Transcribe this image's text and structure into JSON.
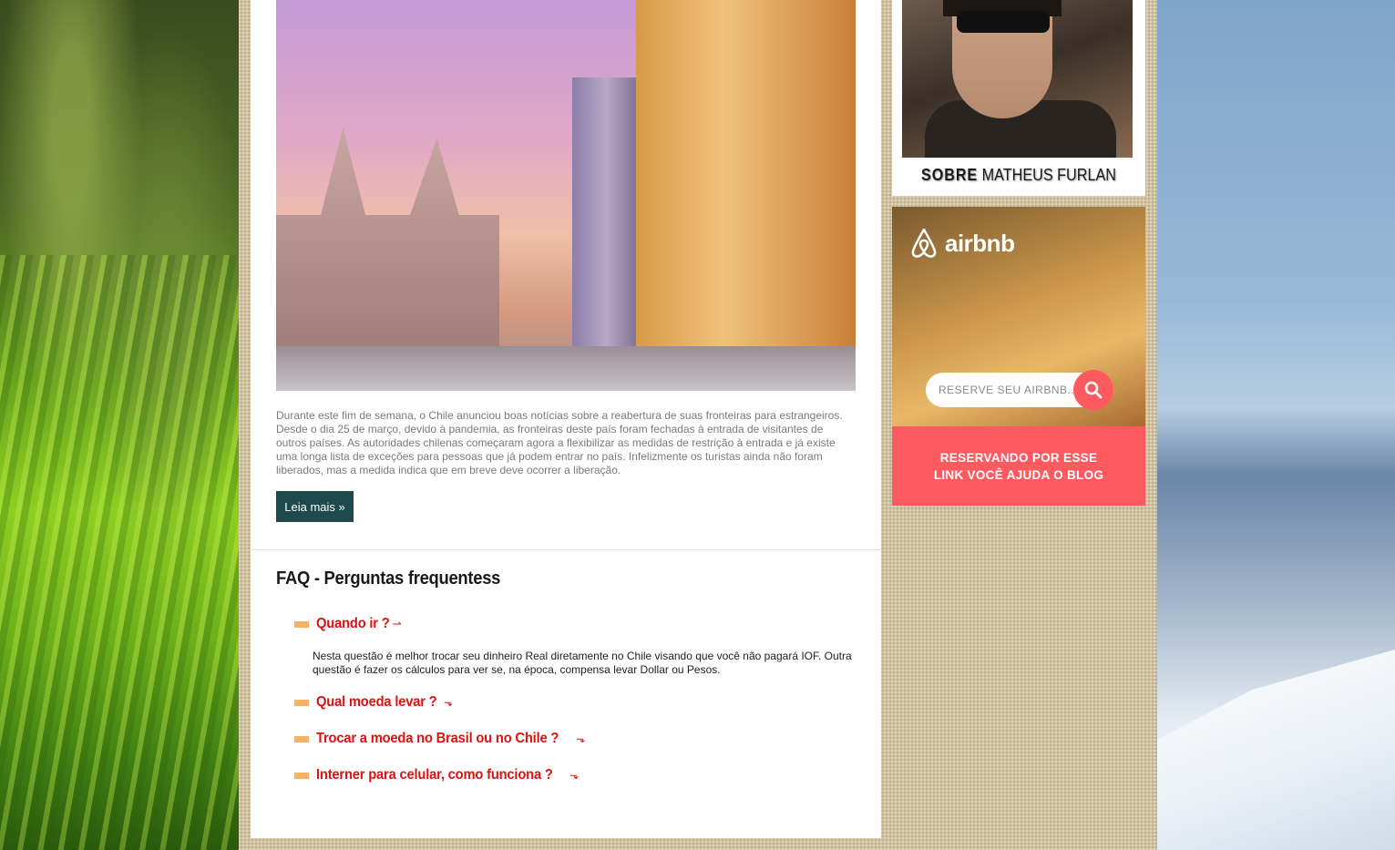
{
  "article": {
    "text": "Durante este fim de semana, o Chile anunciou boas notícias sobre a reabertura de suas fronteiras para estrangeiros. Desde o dia 25 de março, devido à pandemia, as fronteiras deste país foram fechadas à entrada de visitantes de outros países. As autoridades chilenas começaram agora a flexibilizar as medidas de restrição à entrada e já existe uma longa lista de exceções para pessoas que já podem entrar no país. Infelizmente os turistas ainda não foram liberados, mas a medida indica que em breve deve ocorrer a liberação.",
    "read_more_label": "Leia mais »"
  },
  "faq": {
    "title": "FAQ - Perguntas frequentess",
    "items": [
      {
        "question": "Quando ir ?",
        "arrow": "⇀"
      },
      {
        "question": "Qual moeda levar ?",
        "arrow": "⬎"
      },
      {
        "question": "Trocar a moeda no Brasil ou no Chile ?",
        "arrow": "⬎"
      },
      {
        "question": "Interner para celular, como funciona ?",
        "arrow": "⬎"
      }
    ],
    "answer": "Nesta questão é melhor trocar seu dinheiro Real diretamente no Chile visando que você não pagará IOF. Outra questão é fazer os cálculos para ver se, na época, compensa levar Dollar ou Pesos."
  },
  "sidebar": {
    "about": {
      "label_strong": "SOBRE",
      "label_name": "MATHEUS FURLAN"
    },
    "airbnb": {
      "brand": "airbnb",
      "search_placeholder": "RESERVE SEU AIRBNB...",
      "banner_line1": "RESERVANDO POR ESSE",
      "banner_line2": "LINK VOCÊ AJUDA O BLOG",
      "accent_color": "#ff5a5f"
    }
  },
  "colors": {
    "button_bg": "#1e4a4e",
    "faq_question": "#e01010",
    "faq_bullet": "#f4b266"
  }
}
